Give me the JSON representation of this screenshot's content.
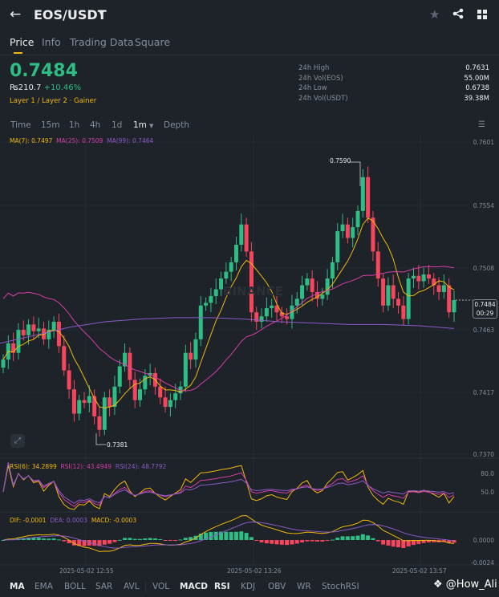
{
  "header": {
    "title": "EOS/USDT",
    "back_icon": "arrow-left-icon",
    "star_icon": "star-icon",
    "share_icon": "share-icon",
    "grid_icon": "grid-icon"
  },
  "tabs": [
    {
      "label": "Price"
    },
    {
      "label": "Info"
    },
    {
      "label": "Trading Data"
    },
    {
      "label": "Square"
    }
  ],
  "ticker": {
    "price": "0.7484",
    "fiat": "₨210.7",
    "change": "+10.46%",
    "tag1": "Layer 1 / Layer 2",
    "tag2": "Gainer"
  },
  "stats": [
    {
      "label": "24h High",
      "value": "0.7631"
    },
    {
      "label": "24h Vol(EOS)",
      "value": "55.00M"
    },
    {
      "label": "24h Low",
      "value": "0.6738"
    },
    {
      "label": "24h Vol(USDT)",
      "value": "39.38M"
    }
  ],
  "intervals": [
    "Time",
    "15m",
    "1h",
    "4h",
    "1d",
    "1m",
    "Depth"
  ],
  "ma_legend": {
    "ma7": "MA(7): 0.7497",
    "ma25": "MA(25): 0.7509",
    "ma99": "MA(99): 0.7464"
  },
  "price_axis": [
    "0.7601",
    "0.7554",
    "0.7508",
    "0.7463",
    "0.7417",
    "0.7370"
  ],
  "high_label": "0.7590",
  "low_label": "0.7381",
  "current": {
    "price": "0.7484",
    "countdown": "00:29"
  },
  "watermark": "BINANCE",
  "rsi_legend": {
    "r6": "RSI(6): 34.2899",
    "r12": "RSI(12): 43.4949",
    "r24": "RSI(24): 48.7792"
  },
  "rsi_axis": [
    "80.0",
    "50.0"
  ],
  "macd_legend": {
    "dif": "DIF: -0.0001",
    "dea": "DEA: 0.0003",
    "macd": "MACD: -0.0003"
  },
  "macd_axis": [
    "0.0000",
    "-0.0024"
  ],
  "dates": [
    "2025-05-02 12:55",
    "2025-05-02 13:26",
    "2025-05-02 13:57"
  ],
  "indicators": [
    "MA",
    "EMA",
    "BOLL",
    "SAR",
    "AVL",
    "VOL",
    "MACD",
    "RSI",
    "KDJ",
    "OBV",
    "WR",
    "StochRSI"
  ],
  "watermark_user": "@How_Ali",
  "colors": {
    "up": "#2ebd85",
    "down": "#f6465d",
    "ma7": "#f0b90b",
    "ma25": "#d63ea8",
    "ma99": "#8a5cc7"
  },
  "chart_data": {
    "type": "candlestick",
    "ylim": [
      0.737,
      0.7601
    ],
    "closes": [
      0.744,
      0.7452,
      0.7445,
      0.7462,
      0.7458,
      0.7466,
      0.7461,
      0.7463,
      0.7455,
      0.7462,
      0.7468,
      0.745,
      0.7432,
      0.7418,
      0.74,
      0.741,
      0.7408,
      0.7413,
      0.7398,
      0.7388,
      0.7412,
      0.7405,
      0.742,
      0.7435,
      0.7445,
      0.7425,
      0.741,
      0.7418,
      0.7428,
      0.743,
      0.742,
      0.7412,
      0.7405,
      0.741,
      0.7415,
      0.742,
      0.7445,
      0.744,
      0.7455,
      0.748,
      0.7482,
      0.7487,
      0.7492,
      0.75,
      0.7505,
      0.7512,
      0.7525,
      0.754,
      0.752,
      0.7475,
      0.7468,
      0.7472,
      0.7478,
      0.748,
      0.7475,
      0.7472,
      0.747,
      0.748,
      0.7485,
      0.7495,
      0.75,
      0.749,
      0.7485,
      0.7488,
      0.75,
      0.7512,
      0.7535,
      0.754,
      0.753,
      0.7538,
      0.755,
      0.7575,
      0.7545,
      0.752,
      0.75,
      0.748,
      0.7495,
      0.7485,
      0.748,
      0.747,
      0.75,
      0.7502,
      0.7498,
      0.7503,
      0.75,
      0.7495,
      0.749,
      0.7495,
      0.7475,
      0.7484
    ],
    "ma99": [
      0.7452,
      0.7458,
      0.7464,
      0.7468,
      0.747,
      0.7471,
      0.7471,
      0.747,
      0.7468,
      0.7467,
      0.7466,
      0.7466,
      0.7465,
      0.7463
    ]
  }
}
